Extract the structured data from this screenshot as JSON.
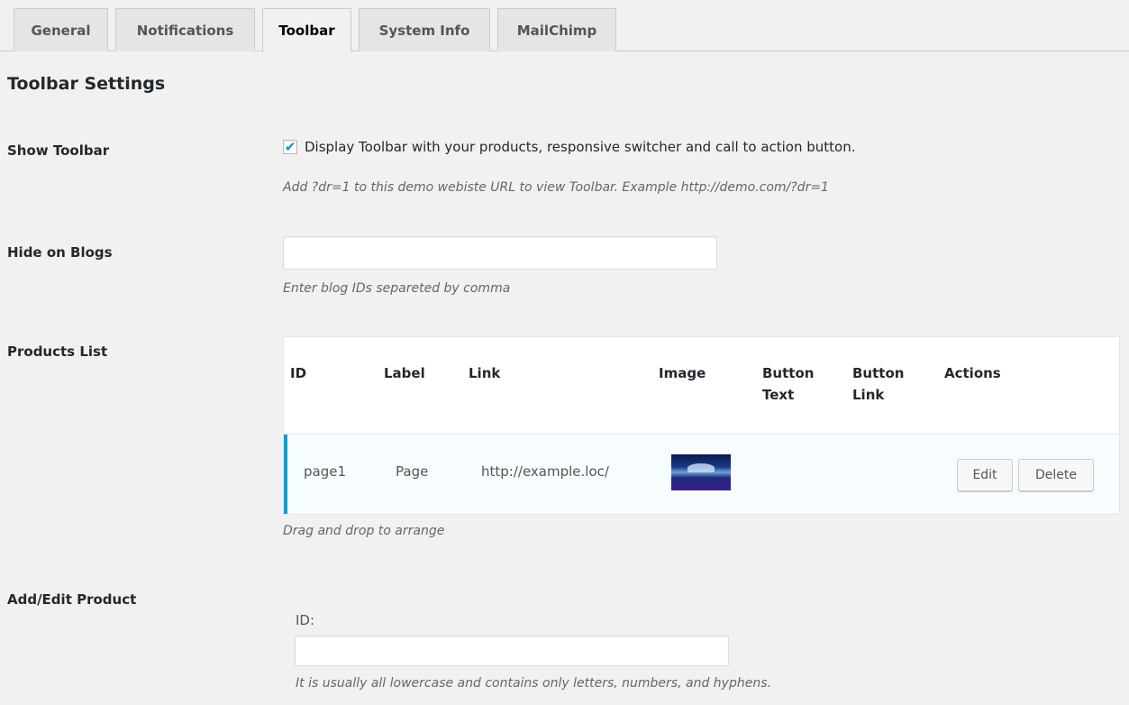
{
  "tabs": [
    {
      "label": "General"
    },
    {
      "label": "Notifications"
    },
    {
      "label": "Toolbar",
      "active": true
    },
    {
      "label": "System Info"
    },
    {
      "label": "MailChimp"
    }
  ],
  "section_title": "Toolbar Settings",
  "show_toolbar": {
    "label": "Show Toolbar",
    "checked": true,
    "checkbox_text": "Display Toolbar with your products, responsive switcher and call to action button.",
    "description": "Add ?dr=1 to this demo webiste URL to view Toolbar. Example http://demo.com/?dr=1"
  },
  "hide_on_blogs": {
    "label": "Hide on Blogs",
    "value": "",
    "description": "Enter blog IDs separeted by comma"
  },
  "products_list": {
    "label": "Products List",
    "headers": {
      "id": "ID",
      "label": "Label",
      "link": "Link",
      "image": "Image",
      "button_text": "Button Text",
      "button_link": "Button Link",
      "actions": "Actions"
    },
    "rows": [
      {
        "id": "page1",
        "label": "Page",
        "link": "http://example.loc/",
        "image": "product-thumbnail",
        "button_text": "",
        "button_link": "",
        "edit_label": "Edit",
        "delete_label": "Delete"
      }
    ],
    "description": "Drag and drop to arrange"
  },
  "add_edit_product": {
    "label": "Add/Edit Product",
    "id_label": "ID:",
    "id_value": "",
    "id_description": "It is usually all lowercase and contains only letters, numbers, and hyphens."
  },
  "colors": {
    "accent": "#00a0d2",
    "checkmark": "#1e8cbe",
    "background": "#f1f1f1"
  }
}
